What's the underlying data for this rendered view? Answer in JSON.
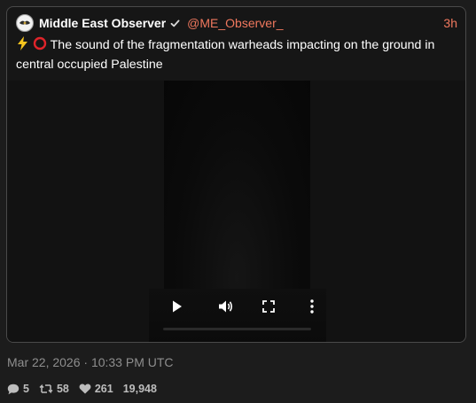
{
  "post": {
    "author_name": "Middle East Observer",
    "handle": "@ME_Observer_",
    "time_ago": "3h",
    "text": "The sound of the fragmentation warheads impacting on the ground in central occupied Palestine",
    "emojis": [
      "lightning-icon",
      "red-circle-icon"
    ],
    "avatar_icon": "observer-logo-icon",
    "verified_icon": "verified-check-icon"
  },
  "media": {
    "type": "video",
    "controls": [
      "play-icon",
      "volume-icon",
      "fullscreen-icon",
      "more-options-icon"
    ]
  },
  "meta": {
    "date": "Mar 22, 2026 · 10:33 PM UTC"
  },
  "stats": {
    "replies": "5",
    "retweets": "58",
    "likes": "261",
    "views": "19,948"
  },
  "colors": {
    "background": "#1c1c1c",
    "card": "#161616",
    "accent": "#f0785e",
    "text": "#ffffff",
    "muted": "#8e8e8e"
  }
}
